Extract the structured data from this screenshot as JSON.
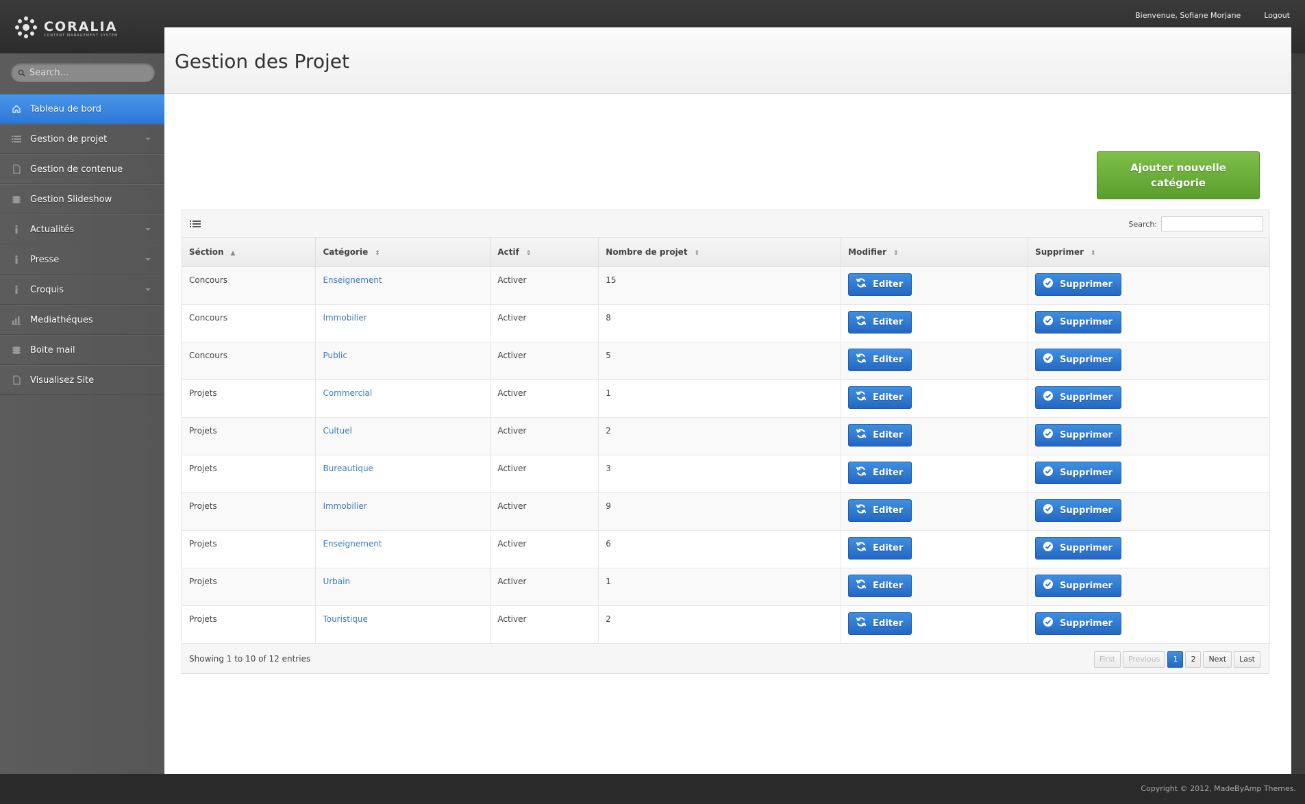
{
  "header": {
    "logo_name": "CORALIA",
    "logo_sub": "CONTENT MANAGEMENT SYSTEM",
    "welcome": "Bienvenue, Sofiane Morjane",
    "logout": "Logout"
  },
  "sidebar": {
    "search_placeholder": "Search...",
    "items": [
      {
        "label": "Tableau de bord",
        "icon": "home-icon",
        "active": true
      },
      {
        "label": "Gestion de projet",
        "icon": "list-icon",
        "caret": true
      },
      {
        "label": "Gestion de contenue",
        "icon": "document-icon"
      },
      {
        "label": "Gestion Slideshow",
        "icon": "layers-icon"
      },
      {
        "label": "Actualités",
        "icon": "info-icon",
        "caret": true
      },
      {
        "label": "Presse",
        "icon": "info-icon",
        "caret": true
      },
      {
        "label": "Croquis",
        "icon": "info-icon",
        "caret": true
      },
      {
        "label": "Mediathéques",
        "icon": "chart-icon"
      },
      {
        "label": "Boite mail",
        "icon": "layers-icon"
      },
      {
        "label": "Visualisez Site",
        "icon": "document-icon"
      }
    ]
  },
  "main": {
    "title": "Gestion des Projet",
    "add_button": "Ajouter nouvelle catégorie",
    "search_label": "Search:",
    "columns": [
      "Séction",
      "Catégorie",
      "Actif",
      "Nombre de projet",
      "Modifier",
      "Supprimer"
    ],
    "rows": [
      {
        "section": "Concours",
        "categorie": "Enseignement",
        "actif": "Activer",
        "nombre": "15"
      },
      {
        "section": "Concours",
        "categorie": "Immobilier",
        "actif": "Activer",
        "nombre": "8"
      },
      {
        "section": "Concours",
        "categorie": "Public",
        "actif": "Activer",
        "nombre": "5"
      },
      {
        "section": "Projets",
        "categorie": "Commercial",
        "actif": "Activer",
        "nombre": "1"
      },
      {
        "section": "Projets",
        "categorie": "Cultuel",
        "actif": "Activer",
        "nombre": "2"
      },
      {
        "section": "Projets",
        "categorie": "Bureautique",
        "actif": "Activer",
        "nombre": "3"
      },
      {
        "section": "Projets",
        "categorie": "Immobilier",
        "actif": "Activer",
        "nombre": "9"
      },
      {
        "section": "Projets",
        "categorie": "Enseignement",
        "actif": "Activer",
        "nombre": "6"
      },
      {
        "section": "Projets",
        "categorie": "Urbain",
        "actif": "Activer",
        "nombre": "1"
      },
      {
        "section": "Projets",
        "categorie": "Touristique",
        "actif": "Activer",
        "nombre": "2"
      }
    ],
    "edit_label": "Editer",
    "delete_label": "Supprimer",
    "info": "Showing 1 to 10 of 12 entries",
    "pager": {
      "first": "First",
      "previous": "Previous",
      "pages": [
        "1",
        "2"
      ],
      "next": "Next",
      "last": "Last"
    }
  },
  "footer": {
    "copyright": "Copyright © 2012, MadeByAmp Themes."
  },
  "colors": {
    "accent": "#2c78d8",
    "add_button": "#6aae38",
    "link": "#3b7bbf"
  }
}
